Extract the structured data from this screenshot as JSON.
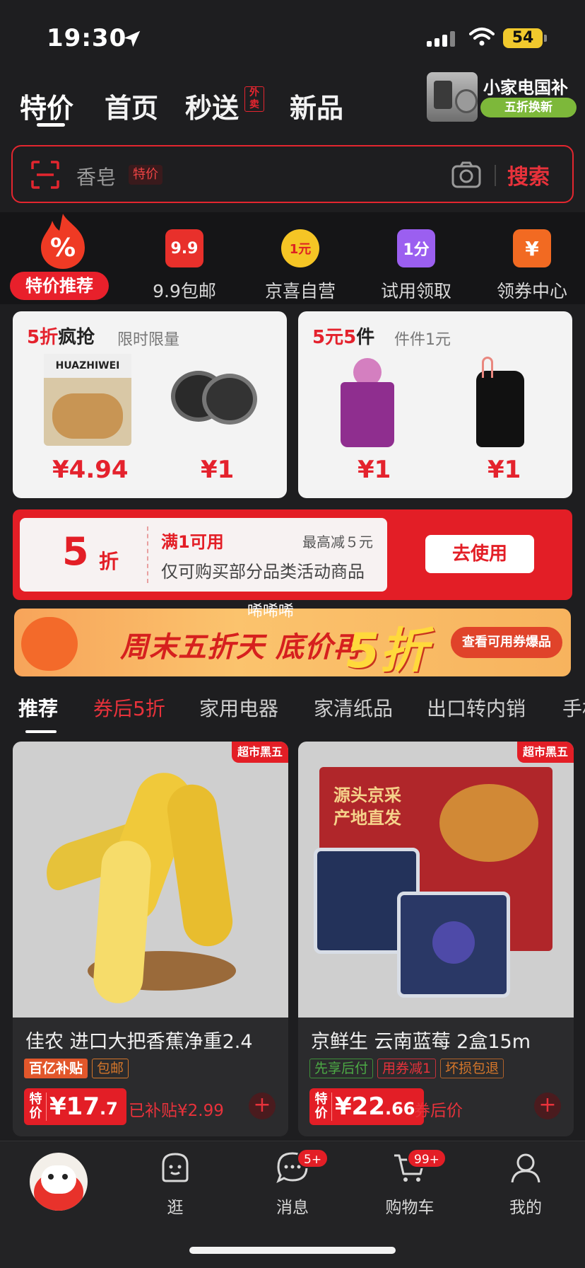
{
  "status": {
    "time": "19:30",
    "battery": "54"
  },
  "topnav": {
    "tabs": [
      "特价",
      "首页",
      "秒送",
      "新品"
    ],
    "waimai": "外卖",
    "promo_title": "小家电国补",
    "promo_sub": "五折换新"
  },
  "search": {
    "placeholder": "香皂",
    "tag": "特价",
    "button": "搜索"
  },
  "categories": {
    "hot": "特价推荐",
    "items": [
      {
        "label": "9.9包邮",
        "icon": "9.9"
      },
      {
        "label": "京喜自营",
        "icon": "1元"
      },
      {
        "label": "试用领取",
        "icon": "1分"
      },
      {
        "label": "领券中心",
        "icon": "¥"
      }
    ]
  },
  "deals": [
    {
      "title_red": "5折",
      "title_rest": "疯抢",
      "sub": "限时限量",
      "prices": [
        "¥4.94",
        "¥1"
      ],
      "brand": "HUAZHIWEI"
    },
    {
      "title_red": "5元5",
      "title_rest": "件",
      "sub": "件件1元",
      "prices": [
        "¥1",
        "¥1"
      ]
    }
  ],
  "coupon": {
    "num": "5",
    "zhe": "折",
    "cond": "满1可用",
    "max": "最高减５元",
    "desc": "仅可购买部分品类活动商品",
    "use": "去使用"
  },
  "watermark": "唏唏唏",
  "banner": {
    "text": "周末五折天 底价再",
    "big": "5折",
    "see": "查看可用券爆品"
  },
  "feed_tabs": [
    "推荐",
    "券后5折",
    "家用电器",
    "家清纸品",
    "出口转内销",
    "手机"
  ],
  "products": [
    {
      "badge": "超市黑五",
      "name": "佳农 进口大把香蕉净重2.4",
      "tags": [
        "百亿补贴",
        "包邮"
      ],
      "price_label": "特价",
      "price_int": "¥17",
      "price_dec": ".7",
      "extra": "已补贴¥2.99",
      "plus": "+"
    },
    {
      "badge": "超市黑五",
      "name": "京鲜生 云南蓝莓 2盒15m",
      "tags": [
        "先享后付",
        "用券减1",
        "坏损包退"
      ],
      "price_label": "特价",
      "price_int": "¥22",
      "price_dec": ".66",
      "extra": "券后价",
      "plus": "+",
      "box_text": "源头京采 产地直发"
    }
  ],
  "bottombar": {
    "items": [
      "逛",
      "消息",
      "购物车",
      "我的"
    ],
    "msg_badge": "5+",
    "cart_badge": "99+"
  }
}
